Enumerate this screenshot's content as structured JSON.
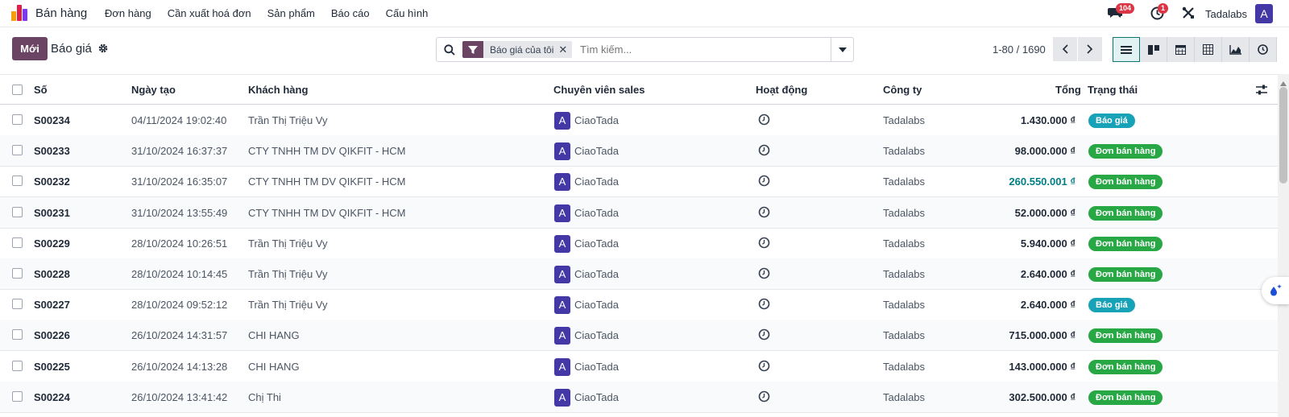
{
  "app": {
    "title": "Bán hàng"
  },
  "menu": [
    "Đơn hàng",
    "Cần xuất hoá đơn",
    "Sản phẩm",
    "Báo cáo",
    "Cấu hình"
  ],
  "systray": {
    "messages_count": "104",
    "activities_count": "1",
    "company": "Tadalabs",
    "user_initial": "A"
  },
  "control": {
    "new_label": "Mới",
    "breadcrumb": "Báo giá",
    "search_facet": "Báo giá của tôi",
    "search_placeholder": "Tìm kiếm...",
    "pager": "1-80 / 1690"
  },
  "columns": {
    "number": "Số",
    "date": "Ngày tạo",
    "customer": "Khách hàng",
    "salesperson": "Chuyên viên sales",
    "activity": "Hoạt động",
    "company": "Công ty",
    "total": "Tổng",
    "status": "Trạng thái"
  },
  "rows": [
    {
      "number": "S00234",
      "date": "04/11/2024 19:02:40",
      "customer": "Trần Thị Triệu Vy",
      "sp_initial": "A",
      "salesperson": "CiaoTada",
      "company": "Tadalabs",
      "total": "1.430.000 ₫",
      "status": "Báo giá"
    },
    {
      "number": "S00233",
      "date": "31/10/2024 16:37:37",
      "customer": "CTY TNHH TM DV QIKFIT - HCM",
      "sp_initial": "A",
      "salesperson": "CiaoTada",
      "company": "Tadalabs",
      "total": "98.000.000 ₫",
      "status": "Đơn bán hàng"
    },
    {
      "number": "S00232",
      "date": "31/10/2024 16:35:07",
      "customer": "CTY TNHH TM DV QIKFIT - HCM",
      "sp_initial": "A",
      "salesperson": "CiaoTada",
      "company": "Tadalabs",
      "total": "260.550.001 ₫",
      "status": "Đơn bán hàng"
    },
    {
      "number": "S00231",
      "date": "31/10/2024 13:55:49",
      "customer": "CTY TNHH TM DV QIKFIT - HCM",
      "sp_initial": "A",
      "salesperson": "CiaoTada",
      "company": "Tadalabs",
      "total": "52.000.000 ₫",
      "status": "Đơn bán hàng"
    },
    {
      "number": "S00229",
      "date": "28/10/2024 10:26:51",
      "customer": "Trần Thị Triệu Vy",
      "sp_initial": "A",
      "salesperson": "CiaoTada",
      "company": "Tadalabs",
      "total": "5.940.000 ₫",
      "status": "Đơn bán hàng"
    },
    {
      "number": "S00228",
      "date": "28/10/2024 10:14:45",
      "customer": "Trần Thị Triệu Vy",
      "sp_initial": "A",
      "salesperson": "CiaoTada",
      "company": "Tadalabs",
      "total": "2.640.000 ₫",
      "status": "Đơn bán hàng"
    },
    {
      "number": "S00227",
      "date": "28/10/2024 09:52:12",
      "customer": "Trần Thị Triệu Vy",
      "sp_initial": "A",
      "salesperson": "CiaoTada",
      "company": "Tadalabs",
      "total": "2.640.000 ₫",
      "status": "Báo giá"
    },
    {
      "number": "S00226",
      "date": "26/10/2024 14:31:57",
      "customer": "CHI HANG",
      "sp_initial": "A",
      "salesperson": "CiaoTada",
      "company": "Tadalabs",
      "total": "715.000.000 ₫",
      "status": "Đơn bán hàng"
    },
    {
      "number": "S00225",
      "date": "26/10/2024 14:13:28",
      "customer": "CHI HANG",
      "sp_initial": "A",
      "salesperson": "CiaoTada",
      "company": "Tadalabs",
      "total": "143.000.000 ₫",
      "status": "Đơn bán hàng"
    },
    {
      "number": "S00224",
      "date": "26/10/2024 13:41:42",
      "customer": "Chị Thi",
      "sp_initial": "A",
      "salesperson": "CiaoTada",
      "company": "Tadalabs",
      "total": "302.500.000 ₫",
      "status": "Đơn bán hàng"
    }
  ],
  "colors": {
    "brand": "#6b4464",
    "quotation_badge": "#17a2b8",
    "order_badge": "#28a745",
    "avatar": "#4338a5",
    "link_total": "#017e84"
  },
  "icons": {
    "view_switcher": [
      "list-icon",
      "kanban-icon",
      "calendar-icon",
      "pivot-icon",
      "graph-icon",
      "activity-icon"
    ]
  }
}
